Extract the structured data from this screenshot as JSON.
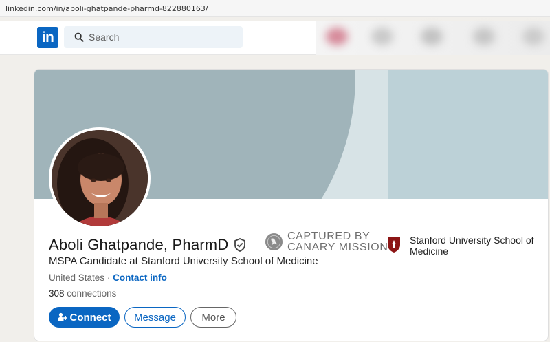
{
  "browser": {
    "url": "linkedin.com/in/aboli-ghatpande-pharmd-822880163/"
  },
  "nav": {
    "logo": "in",
    "search_placeholder": "Search"
  },
  "profile": {
    "name": "Aboli Ghatpande, PharmD",
    "headline": "MSPA Candidate at Stanford University School of Medicine",
    "location": "United States",
    "separator": "·",
    "contact_info": "Contact info",
    "connections_count": "308",
    "connections_label": "connections"
  },
  "overlay": {
    "line1": "CAPTURED BY",
    "line2": "CANARY MISSION"
  },
  "education": {
    "school": "Stanford University School of Medicine"
  },
  "actions": {
    "connect": "Connect",
    "message": "Message",
    "more": "More"
  },
  "colors": {
    "brand": "#0a66c2",
    "banner": "#a0b4ba",
    "stanford_red": "#8c1515"
  },
  "icons": [
    "search-icon",
    "verified-shield-icon",
    "canary-mission-logo-icon",
    "stanford-shield-icon",
    "add-person-icon"
  ]
}
